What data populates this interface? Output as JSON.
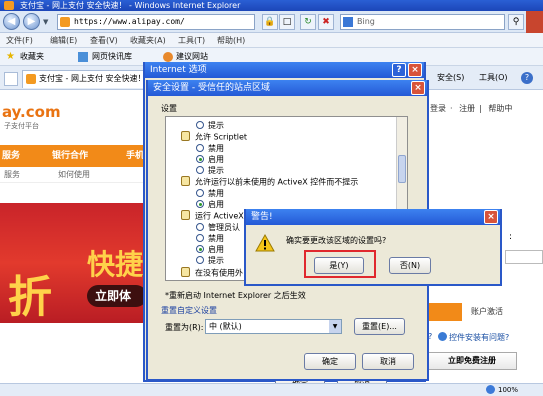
{
  "browser": {
    "title": "支付宝 - 网上支付 安全快速！ - Windows Internet Explorer",
    "url": "https://www.alipay.com/",
    "search_placeholder": "Bing",
    "menu": [
      "文件(F)",
      "编辑(E)",
      "查看(V)",
      "收藏夹(A)",
      "工具(T)",
      "帮助(H)"
    ],
    "favorites_label": "收藏夹",
    "fav_link": "网页快讯库",
    "fav_link2": "建议网站",
    "tab_label": "支付宝 - 网上支付 安全快速！",
    "toolbar_right": [
      "安全(S)",
      "工具(O)"
    ],
    "status_zoom": "100%"
  },
  "page": {
    "logo": "ay.com",
    "logo_sub": "子支付平台",
    "nav": [
      "服务",
      "银行合作",
      "手机"
    ],
    "subnav": [
      "服务",
      "如何使用"
    ],
    "top_links": [
      "登录",
      "注册",
      "帮助中"
    ],
    "banner_big": "快捷",
    "banner_zhe": "折",
    "banner_pill": "立即体",
    "account_activate": "账户激活",
    "control_issue": "控件安装有问题?",
    "free_register": "立即免费注册",
    "question_mark": "?",
    "colon_mark": ":"
  },
  "internet_options": {
    "title": "Internet 选项",
    "ok": "确定",
    "cancel": "取消"
  },
  "security_settings": {
    "title": "安全设置 - 受信任的站点区域",
    "group_label": "设置",
    "items": [
      {
        "type": "radio",
        "label": "提示",
        "checked": false
      },
      {
        "type": "header",
        "label": "允许 Scriptlet"
      },
      {
        "type": "radio",
        "label": "禁用",
        "checked": false
      },
      {
        "type": "radio",
        "label": "启用",
        "checked": true
      },
      {
        "type": "radio",
        "label": "提示",
        "checked": false
      },
      {
        "type": "header",
        "label": "允许运行以前未使用的 ActiveX 控件而不提示"
      },
      {
        "type": "radio",
        "label": "禁用",
        "checked": false
      },
      {
        "type": "radio",
        "label": "启用",
        "checked": true
      },
      {
        "type": "header",
        "label": "运行 ActiveX"
      },
      {
        "type": "radio",
        "label": "管理员认"
      },
      {
        "type": "radio",
        "label": "禁用",
        "checked": false
      },
      {
        "type": "radio",
        "label": "启用",
        "checked": true
      },
      {
        "type": "radio",
        "label": "提示",
        "checked": false
      },
      {
        "type": "header",
        "label": "在没有使用外"
      }
    ],
    "restart_note": "*重新启动 Internet Explorer 之后生效",
    "reset_group": "重置自定义设置",
    "reset_to_label": "重置为(R):",
    "reset_value": "中 (默认)",
    "reset_button": "重置(E)...",
    "ok": "确定",
    "cancel": "取消"
  },
  "warning": {
    "title": "警告!",
    "message": "确实要更改该区域的设置吗?",
    "yes": "是(Y)",
    "no": "否(N)"
  },
  "colors": {
    "title_blue": "#2459d6",
    "alipay_orange": "#f28a18",
    "highlight_red": "#e0282d"
  }
}
